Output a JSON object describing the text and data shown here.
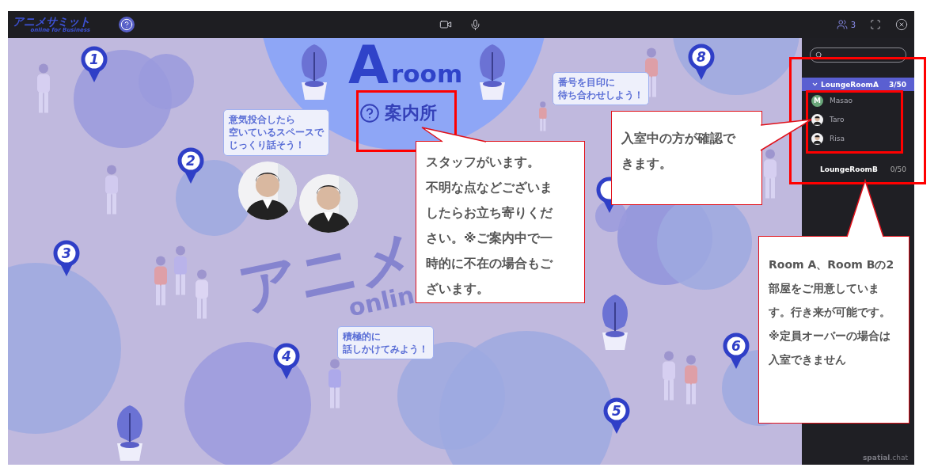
{
  "top_bar": {
    "logo": "アニメサミット",
    "logo_subtitle": "online for Business",
    "participant_count": "3"
  },
  "map": {
    "room_letter": "A",
    "room_word": "room",
    "info_desk": "案内所",
    "backdrop_texts": [
      "アニメ",
      "onlin"
    ],
    "pins": [
      {
        "label": "1"
      },
      {
        "label": "2"
      },
      {
        "label": "3"
      },
      {
        "label": "4"
      },
      {
        "label": "5"
      },
      {
        "label": "6"
      },
      {
        "label": "8"
      }
    ],
    "speech_bubbles": [
      {
        "lines": [
          "意気投合したら",
          "空いているスペースで",
          "じっくり話そう！"
        ]
      },
      {
        "lines": [
          "番号を目印に",
          "待ち合わせしよう！"
        ]
      },
      {
        "lines": [
          "積極的に",
          "話しかけてみよう！"
        ]
      }
    ]
  },
  "sidebar": {
    "rooms": [
      {
        "name": "LoungeRoomA",
        "count": "3/50",
        "selected": true,
        "expanded": true,
        "members": [
          {
            "name": "Masao",
            "kind": "initial",
            "initial": "M"
          },
          {
            "name": "Taro"
          },
          {
            "name": "Risa"
          }
        ]
      },
      {
        "name": "LoungeRoomB",
        "count": "0/50",
        "selected": false,
        "expanded": false
      }
    ],
    "footer": "**spatial**.chat"
  },
  "callouts": [
    {
      "paragraphs": [
        "スタッフがいます。",
        "不明な点などございましたらお立ち寄りください。※ご案内中で一時的に不在の場合もございます。"
      ]
    },
    {
      "paragraphs": [
        "入室中の方が確認できます。"
      ]
    },
    {
      "paragraphs": [
        "Room A、Room Bの2部屋をご用意しています。行き来が可能です。",
        "※定員オーバーの場合は入室できません"
      ]
    }
  ]
}
